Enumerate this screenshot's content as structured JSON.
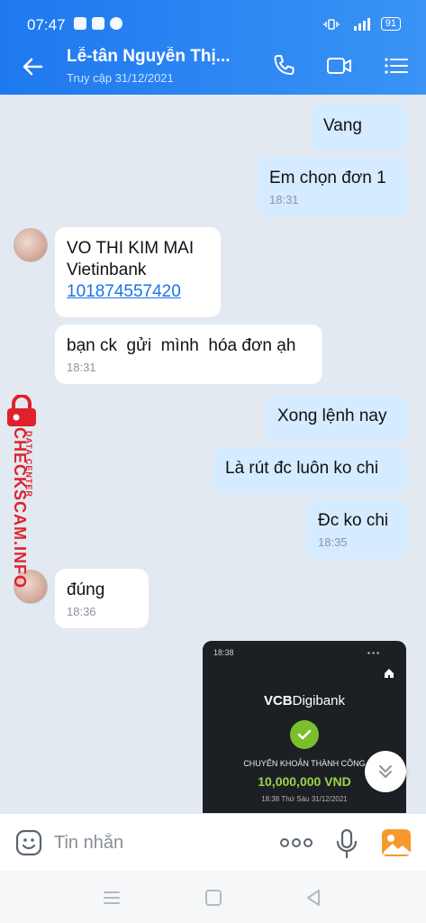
{
  "status": {
    "time": "07:47",
    "battery": "91"
  },
  "header": {
    "title": "Lễ-tân Nguyễn Thị...",
    "subtitle": "Truy cập 31/12/2021"
  },
  "messages": [
    {
      "from": "me",
      "text": "Vang"
    },
    {
      "from": "me",
      "text": "Em chọn đơn 1",
      "time": "18:31"
    },
    {
      "from": "them",
      "line1": "VO THI KIM MAI",
      "line2": "Vietinbank",
      "link": "101874557420"
    },
    {
      "from": "them",
      "text": "bạn ck  gửi  mình  hóa đơn ạh",
      "time": "18:31"
    },
    {
      "from": "me",
      "text": "Xong lệnh nay"
    },
    {
      "from": "me",
      "text": "Là rút đc luôn ko chi"
    },
    {
      "from": "me",
      "text": "Đc ko chi",
      "time": "18:35"
    },
    {
      "from": "them",
      "text": "đúng",
      "time": "18:36"
    }
  ],
  "receipt": {
    "time": "18:38",
    "brand_bold": "VCB",
    "brand_rest": "Digibank",
    "status": "CHUYỂN KHOẢN THÀNH CÔNG",
    "amount": "10,000,000 VND",
    "date": "18:38 Thứ Sáu 31/12/2021"
  },
  "watermark": {
    "main": "CHECKSCAM.INFO",
    "sub": "DATA CENTER"
  },
  "input": {
    "placeholder": "Tin nhắn"
  },
  "colors": {
    "header_start": "#1e78ef",
    "header_end": "#3a93f5",
    "my_bubble": "#d5ebff",
    "their_bubble": "#ffffff",
    "watermark": "#e0202a"
  }
}
